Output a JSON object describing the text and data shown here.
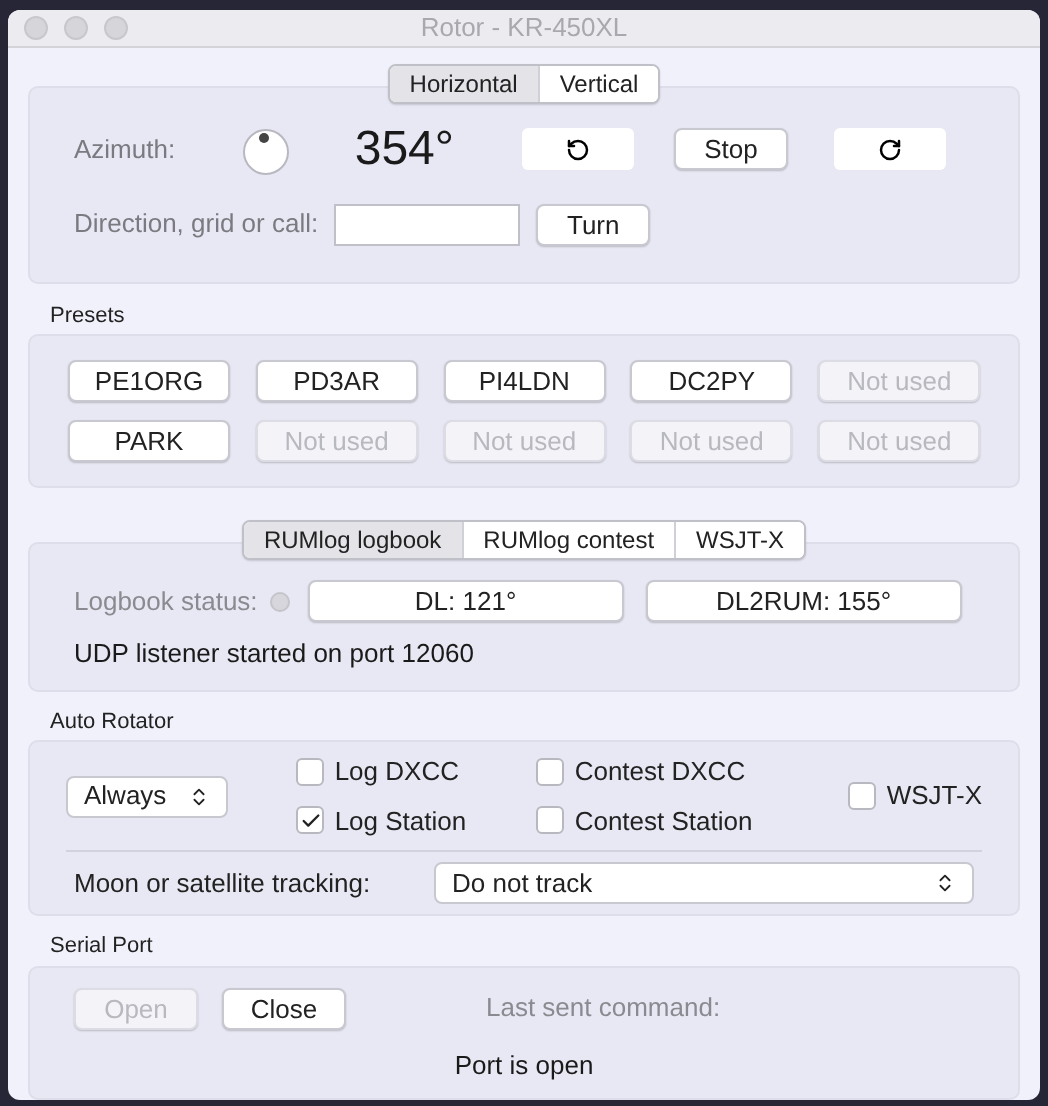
{
  "window": {
    "title": "Rotor - KR-450XL"
  },
  "rotor_tabs": [
    {
      "label": "Horizontal",
      "selected": true
    },
    {
      "label": "Vertical",
      "selected": false
    }
  ],
  "azimuth": {
    "label": "Azimuth:",
    "reading": "354°",
    "stop": "Stop"
  },
  "direction": {
    "label": "Direction, grid or call:",
    "button": "Turn"
  },
  "presets": {
    "title": "Presets",
    "buttons": [
      {
        "label": "PE1ORG",
        "disabled": false
      },
      {
        "label": "PD3AR",
        "disabled": false
      },
      {
        "label": "PI4LDN",
        "disabled": false
      },
      {
        "label": "DC2PY",
        "disabled": false
      },
      {
        "label": "Not used",
        "disabled": true
      },
      {
        "label": "PARK",
        "disabled": false
      },
      {
        "label": "Not used",
        "disabled": true
      },
      {
        "label": "Not used",
        "disabled": true
      },
      {
        "label": "Not used",
        "disabled": true
      },
      {
        "label": "Not used",
        "disabled": true
      }
    ]
  },
  "log_tabs": [
    {
      "label": "RUMlog logbook",
      "selected": true
    },
    {
      "label": "RUMlog contest",
      "selected": false
    },
    {
      "label": "WSJT-X",
      "selected": false
    }
  ],
  "logbook": {
    "label": "Logbook status:",
    "buttons": [
      "DL: 121°",
      "DL2RUM: 155°"
    ],
    "message": "UDP listener started on port 12060"
  },
  "auto_rotator": {
    "title": "Auto Rotator",
    "mode": "Always",
    "checkboxes": [
      {
        "label": "Log DXCC",
        "checked": false
      },
      {
        "label": "Log Station",
        "checked": true
      },
      {
        "label": "Contest DXCC",
        "checked": false
      },
      {
        "label": "Contest Station",
        "checked": false
      },
      {
        "label": "WSJT-X",
        "checked": false
      }
    ],
    "tracking_label": "Moon or satellite tracking:",
    "tracking": "Do not track"
  },
  "serial_port": {
    "title": "Serial Port",
    "buttons": [
      {
        "label": "Open",
        "disabled": true
      },
      {
        "label": "Close",
        "disabled": false
      }
    ],
    "last_command_label": "Last sent command:",
    "status": "Port is open"
  }
}
